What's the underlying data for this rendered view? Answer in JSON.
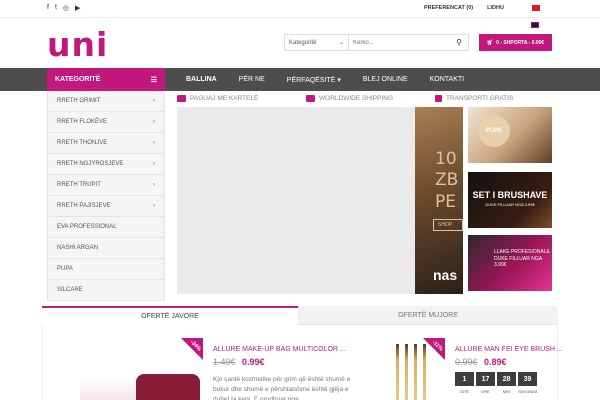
{
  "topbar": {
    "social_icons": [
      "facebook-icon",
      "twitter-icon",
      "instagram-icon",
      "youtube-icon"
    ],
    "favorites": "PREFERENCAT (0)",
    "login": "LIDHU"
  },
  "header": {
    "logo": "uni",
    "search_category": "Kategoritë",
    "search_placeholder": "Kërko...",
    "cart_label": "0 - SHPORTA - 0.00€"
  },
  "nav": {
    "categories_label": "KATEGORITË",
    "links": [
      {
        "label": "BALLINA"
      },
      {
        "label": "PËR NE"
      },
      {
        "label": "PËRFAQËSITË ▾"
      },
      {
        "label": "BLEJ ONLINE"
      },
      {
        "label": "KONTAKTI"
      }
    ]
  },
  "sidebar": {
    "items": [
      {
        "label": "RRETH GRIMIT"
      },
      {
        "label": "RRETH FLOKËVE"
      },
      {
        "label": "RRETH THONJVE"
      },
      {
        "label": "RRETH NGJYROSJEVE"
      },
      {
        "label": "RRETH TRUPIT"
      },
      {
        "label": "RRETH PAJISJEVE"
      },
      {
        "label": "EVA PROFESSIONAL"
      },
      {
        "label": "NASHI ARGAN"
      },
      {
        "label": "PUPA"
      },
      {
        "label": "SILCARE"
      }
    ]
  },
  "features": {
    "card": "PAGUAJ ME KARTELË",
    "shipping": "WORLDWIDE SHIPPING",
    "gift": "TRANSPORTI GRATIS"
  },
  "slider": {
    "headline": "10 ZB PE",
    "button": "SHOP",
    "brand": "nas"
  },
  "tiles": {
    "t1": "PUPA",
    "t2_title": "SET I BRUSHAVE",
    "t2_sub": "DUKE FILLUAR NGA 3.99€",
    "t3": "LLAKE PROFESIONALE DUKE FILLUAR NGA 3.99€"
  },
  "offers": {
    "tab_weekly": "OFERTË JAVORE",
    "tab_monthly": "OFERTË MUJORE",
    "product1": {
      "discount": "-34%",
      "title": "ALLURE MAKE-UP BAG MULTICOLOR ...",
      "old_price": "1.49€",
      "new_price": "0.99€",
      "desc": "Kjo çantë kozmetike për grim që është shumë e bukur dhe shumë e përshtatshme është gjëja e duhet ta keni. E prodhuar nga"
    },
    "product2": {
      "discount": "-11%",
      "title": "ALLURE MAN FEI EYE BRUSH ...",
      "old_price": "0.99€",
      "new_price": "0.89€",
      "countdown": [
        {
          "value": "1",
          "unit": "DITË"
        },
        {
          "value": "17",
          "unit": "ORË"
        },
        {
          "value": "28",
          "unit": "MIN"
        },
        {
          "value": "39",
          "unit": "SEKONDA"
        }
      ]
    }
  },
  "colors": {
    "accent": "#c2187e",
    "nav": "#4d4d4d"
  }
}
